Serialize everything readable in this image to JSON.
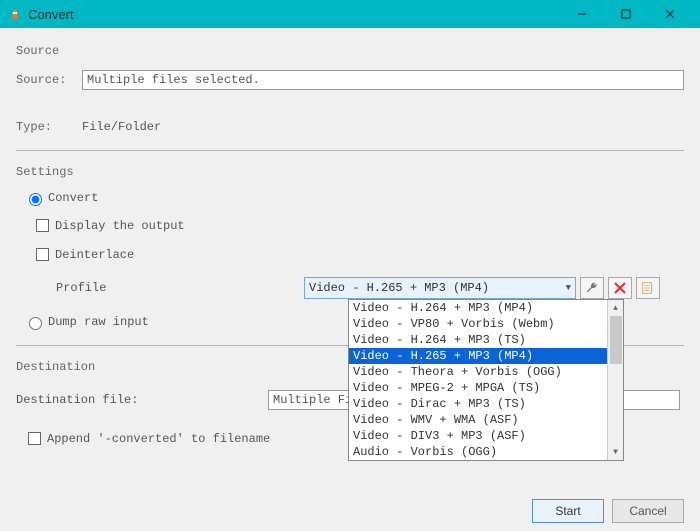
{
  "window": {
    "title": "Convert"
  },
  "source": {
    "section": "Source",
    "label": "Source:",
    "value": "Multiple files selected.",
    "type_label": "Type:",
    "type_value": "File/Folder"
  },
  "settings": {
    "section": "Settings",
    "convert_label": "Convert",
    "display_output_label": "Display the output",
    "deinterlace_label": "Deinterlace",
    "profile_label": "Profile",
    "profile_selected": "Video - H.265 + MP3 (MP4)",
    "profile_options": [
      "Video - H.264 + MP3 (MP4)",
      "Video - VP80 + Vorbis (Webm)",
      "Video - H.264 + MP3 (TS)",
      "Video - H.265 + MP3 (MP4)",
      "Video - Theora + Vorbis (OGG)",
      "Video - MPEG-2 + MPGA (TS)",
      "Video - Dirac + MP3 (TS)",
      "Video - WMV + WMA (ASF)",
      "Video - DIV3 + MP3 (ASF)",
      "Audio - Vorbis (OGG)"
    ],
    "profile_highlight_index": 3,
    "dump_raw_label": "Dump raw input"
  },
  "destination": {
    "section": "Destination",
    "file_label": "Destination file:",
    "file_value": "Multiple Fil",
    "append_label": "Append '-converted' to filename"
  },
  "buttons": {
    "start": "Start",
    "cancel": "Cancel"
  },
  "icons": {
    "tools": "wrench-icon",
    "delete": "x-icon",
    "new": "new-profile-icon"
  }
}
